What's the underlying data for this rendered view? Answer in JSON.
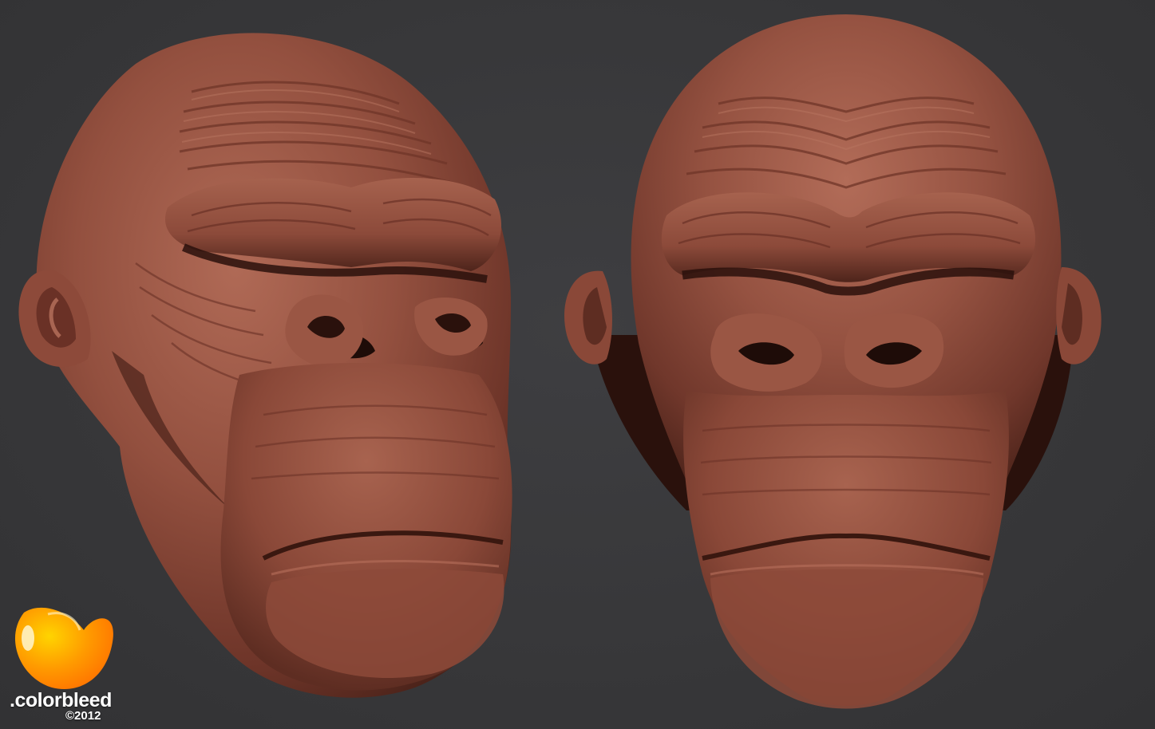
{
  "scene": {
    "background_color": "#3a3a3c",
    "clay_color": "#8e4a3a",
    "clay_highlight": "#b8705c",
    "clay_shadow": "#3a1a14",
    "models": [
      {
        "label": "chimpanzee-head-three-quarter-view"
      },
      {
        "label": "chimpanzee-head-front-view"
      }
    ]
  },
  "logo": {
    "brand": ".colorbleed",
    "copyright": "©2012",
    "accent_color": "#ff8a00",
    "highlight_color": "#ffd400"
  }
}
